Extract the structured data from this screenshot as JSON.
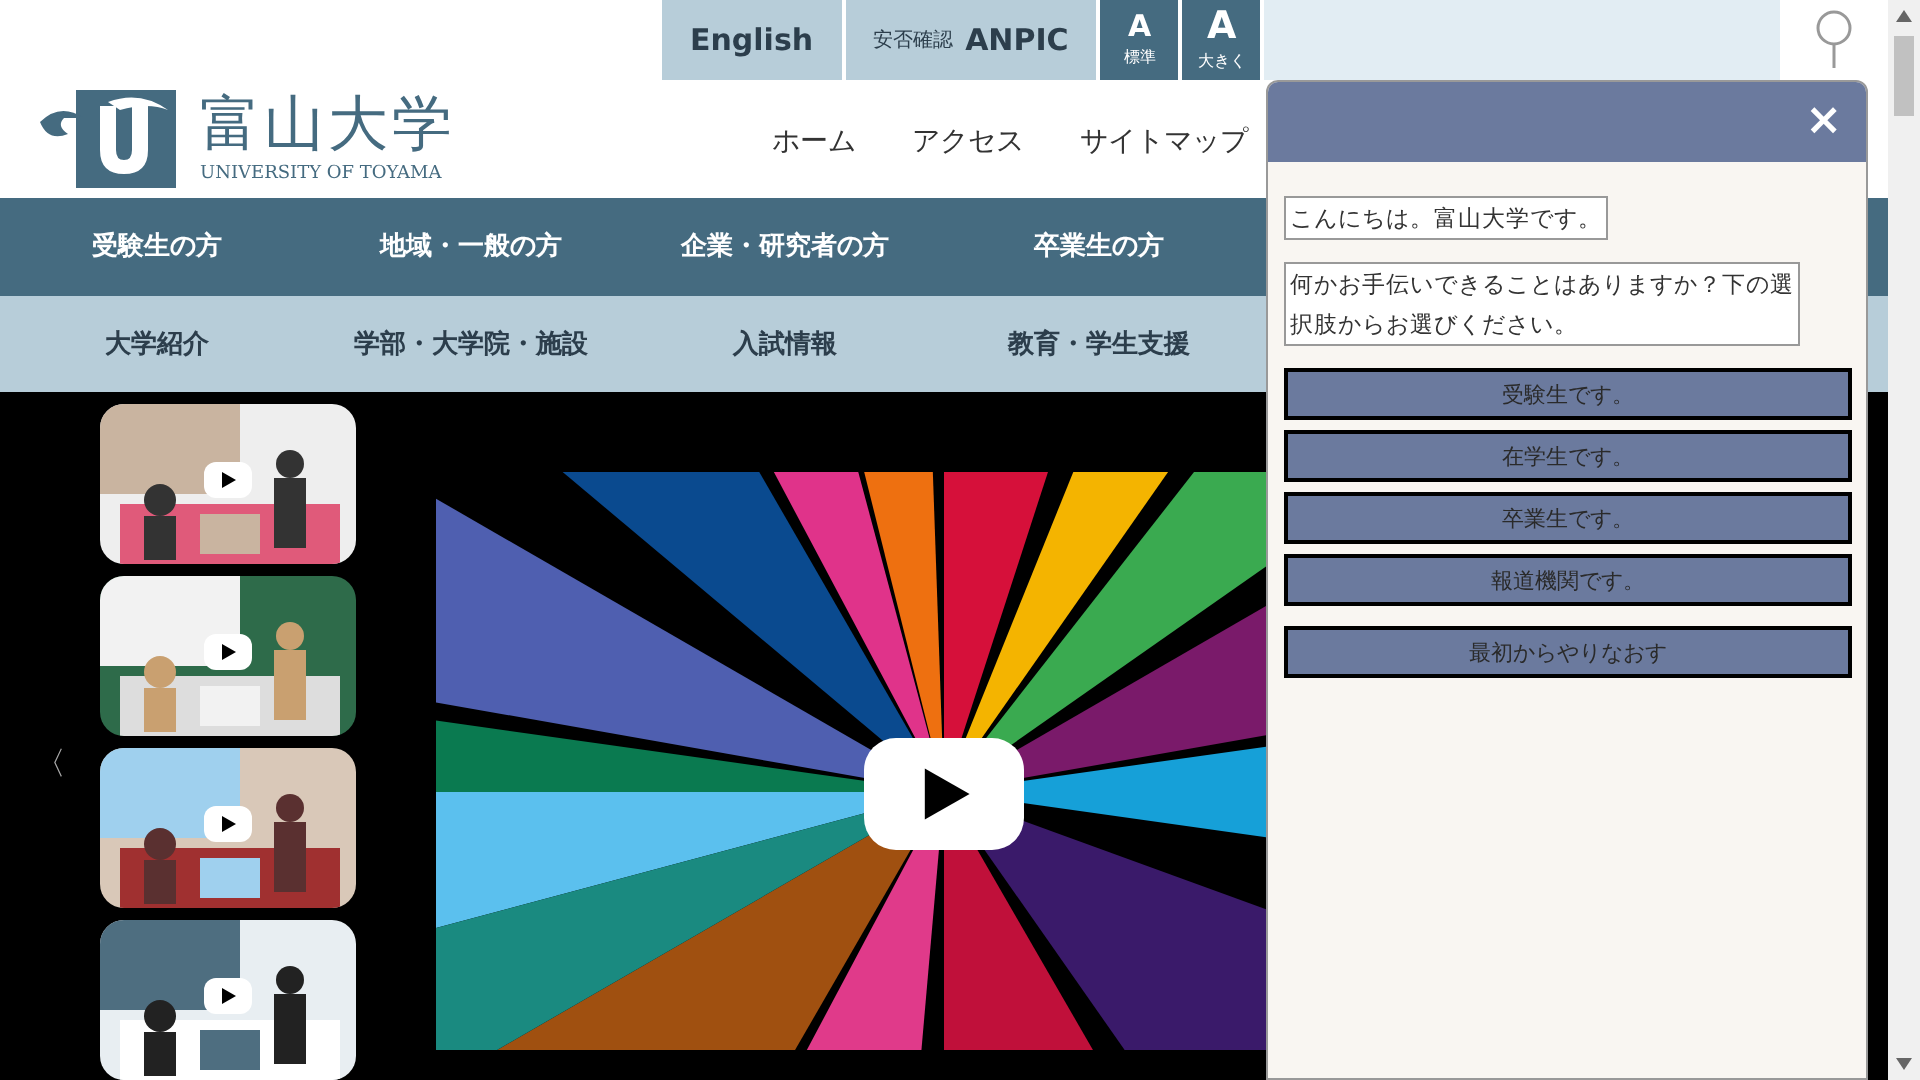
{
  "top_bar": {
    "links": [
      {
        "kind": "plain",
        "label": "English"
      },
      {
        "kind": "prefixed",
        "prefix": "安否確認",
        "label": "ANPIC"
      }
    ],
    "font_sizes": [
      {
        "kind": "standard",
        "letter": "A",
        "caption": "標準"
      },
      {
        "kind": "large",
        "letter": "A",
        "caption": "大きく"
      }
    ]
  },
  "header": {
    "logo_title": "富山大学",
    "logo_subtitle": "UNIVERSITY OF TOYAMA",
    "links": [
      "ホーム",
      "アクセス",
      "サイトマップ"
    ]
  },
  "audience_nav": [
    "受験生の方",
    "地域・一般の方",
    "企業・研究者の方",
    "卒業生の方"
  ],
  "section_nav": [
    "大学紹介",
    "学部・大学院・施設",
    "入試情報",
    "教育・学生支援"
  ],
  "hero": {
    "prev": "〈"
  },
  "chat": {
    "close": "×",
    "messages": [
      "こんにちは。富山大学です。",
      "何かお手伝いできることはありますか？下の選択肢からお選びください。"
    ],
    "options": [
      "受験生です。",
      "在学生です。",
      "卒業生です。",
      "報道機関です。"
    ],
    "restart": "最初からやりなおす"
  }
}
